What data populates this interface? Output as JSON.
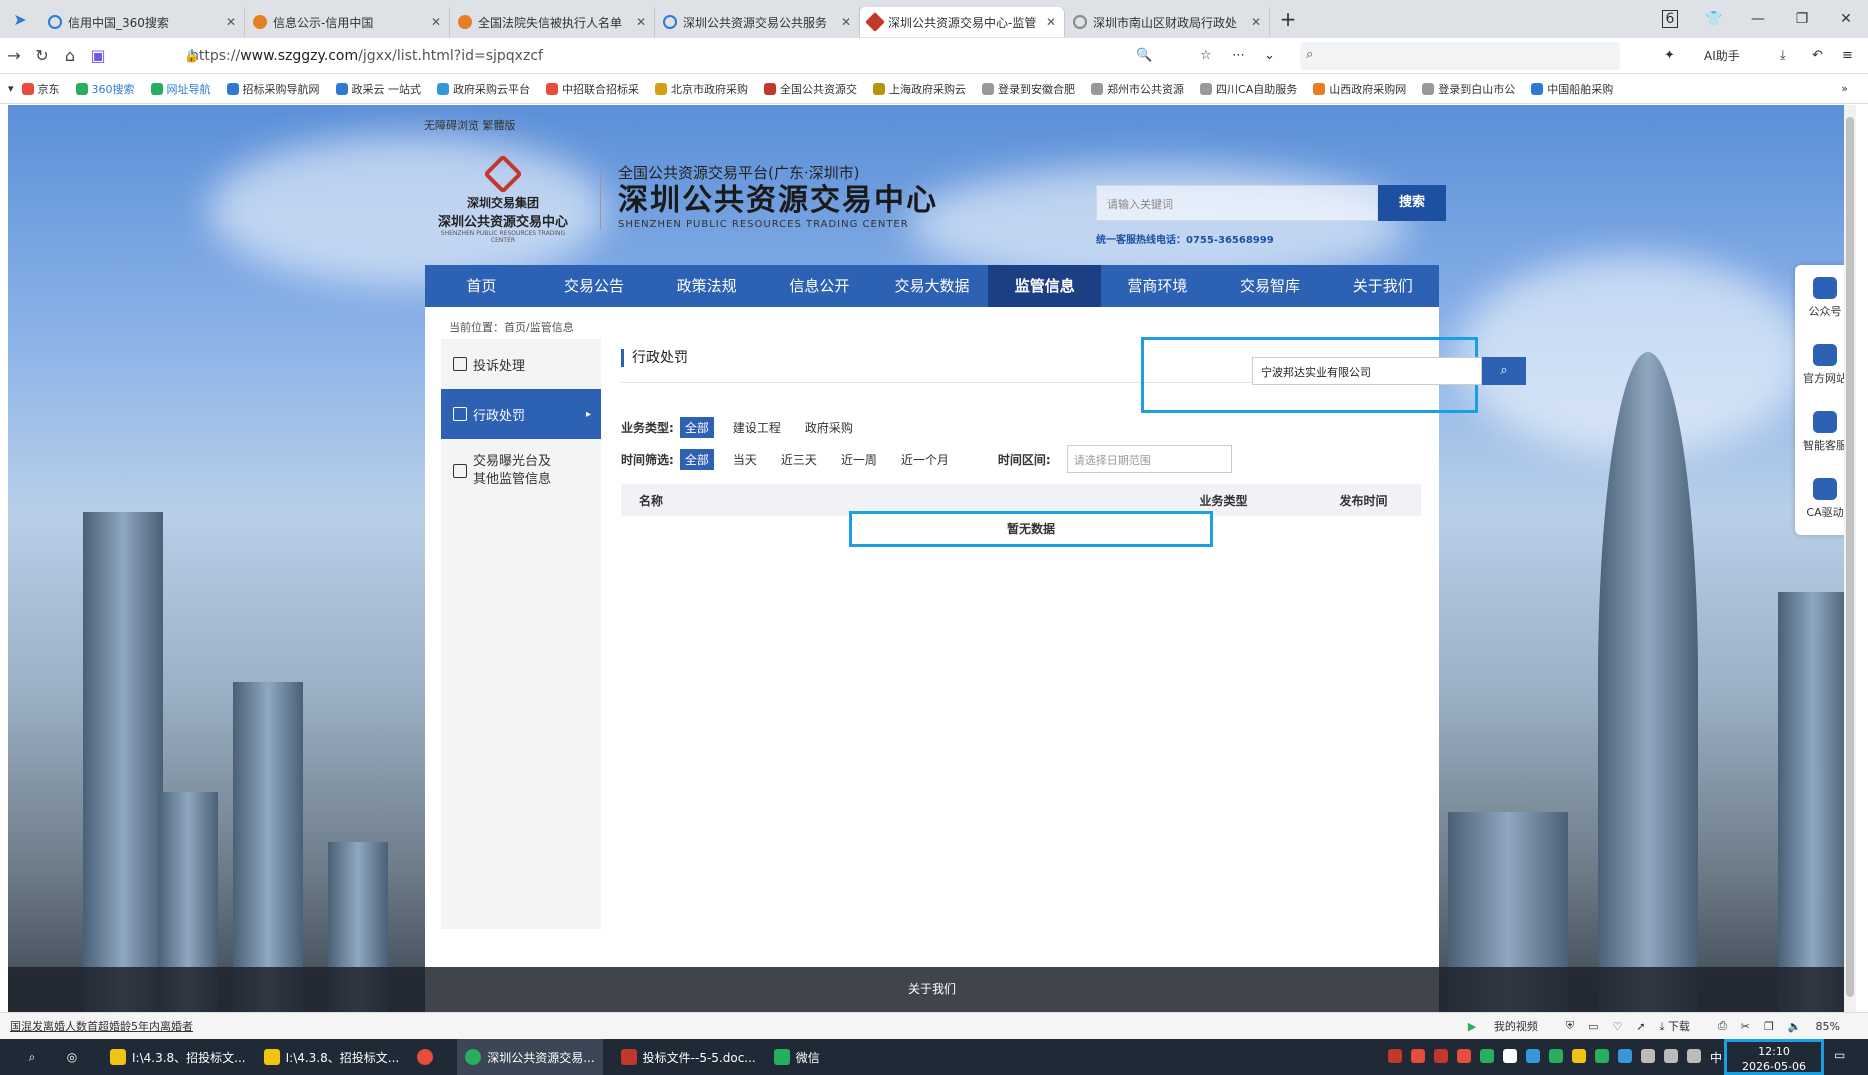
{
  "browser": {
    "tabs": [
      {
        "label": "信用中国_360搜索",
        "color": "#2e7bd1"
      },
      {
        "label": "信息公示-信用中国",
        "color": "#e67e22"
      },
      {
        "label": "全国法院失信被执行人名单",
        "color": "#e67e22"
      },
      {
        "label": "深圳公共资源交易公共服务",
        "color": "#2e7bd1"
      },
      {
        "label": "深圳公共资源交易中心-监管",
        "color": "#c0392b"
      },
      {
        "label": "深圳市南山区财政局行政处",
        "color": "#888888"
      }
    ],
    "active_tab": 4,
    "tab_count_badge": "6",
    "url_prefix": "https://",
    "url_domain": "www.szggzy.com",
    "url_path": "/jgxx/list.html?id=sjpqxzcf",
    "ai_label": "AI助手",
    "bookmarks": [
      "京东",
      "360搜索",
      "网址导航",
      "招标采购导航网",
      "政采云 一站式",
      "政府采购云平台",
      "中招联合招标采",
      "北京市政府采购",
      "全国公共资源交",
      "上海政府采购云",
      "登录到安徽合肥",
      "郑州市公共资源",
      "四川CA自助服务",
      "山西政府采购网",
      "登录到白山市公",
      "中国船舶采购"
    ],
    "bookmark_more": "»"
  },
  "site": {
    "access_links": "无障碍浏览 繁體版",
    "group_name": "深圳交易集团",
    "group_sub": "深圳公共资源交易中心",
    "group_en": "SHENZHEN PUBLIC RESOURCES TRADING CENTER",
    "platform": "全国公共资源交易平台(广东·深圳市)",
    "center_name": "深圳公共资源交易中心",
    "center_en": "SHENZHEN PUBLIC RESOURCES TRADING CENTER",
    "search_placeholder": "请输入关键词",
    "search_button": "搜索",
    "hotline": "统一客服热线电话：0755-36568999",
    "nav": [
      "首页",
      "交易公告",
      "政策法规",
      "信息公开",
      "交易大数据",
      "监管信息",
      "营商环境",
      "交易智库",
      "关于我们"
    ],
    "nav_active": 5,
    "breadcrumb": "当前位置：首页/监管信息",
    "sidebar": [
      "投诉处理",
      "行政处罚",
      "交易曝光台及其他监管信息"
    ],
    "sidebar_active": 1,
    "page_title": "行政处罚",
    "keyword": "宁波邦达实业有限公司",
    "biz_label": "业务类型:",
    "biz_options": [
      "全部",
      "建设工程",
      "政府采购"
    ],
    "time_label": "时间筛选:",
    "time_options": [
      "全部",
      "当天",
      "近三天",
      "近一周",
      "近一个月"
    ],
    "range_label": "时间区间:",
    "range_placeholder": "请选择日期范围",
    "table_headers": [
      "名称",
      "业务类型",
      "发布时间"
    ],
    "empty_text": "暂无数据",
    "footer": "关于我们",
    "float": [
      "公众号",
      "官方网站",
      "智能客服",
      "CA驱动"
    ]
  },
  "status": {
    "news": "国混发离婚人数首超婚龄5年内离婚者",
    "items": [
      "我的视频",
      "下载"
    ],
    "zoom": "85%"
  },
  "taskbar": {
    "items": [
      "I:\\4.3.8、招投标文...",
      "I:\\4.3.8、招投标文...",
      "深圳公共资源交易...",
      "投标文件--5-5.doc...",
      "微信"
    ],
    "active": 2,
    "time": "12:10",
    "date": "2026-05-06",
    "ime": "中"
  }
}
